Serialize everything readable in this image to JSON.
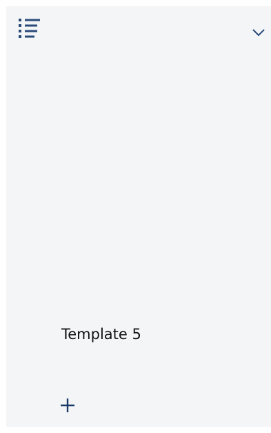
{
  "header": {
    "menu_icon": "list-icon",
    "expand_icon": "chevron-down-icon"
  },
  "items": [
    {
      "label": "Template 5"
    }
  ],
  "footer": {
    "add_icon": "plus-icon"
  },
  "colors": {
    "panel_background": "#f3f5f7",
    "icon_color": "#2a4a78",
    "text_color": "#111111"
  }
}
